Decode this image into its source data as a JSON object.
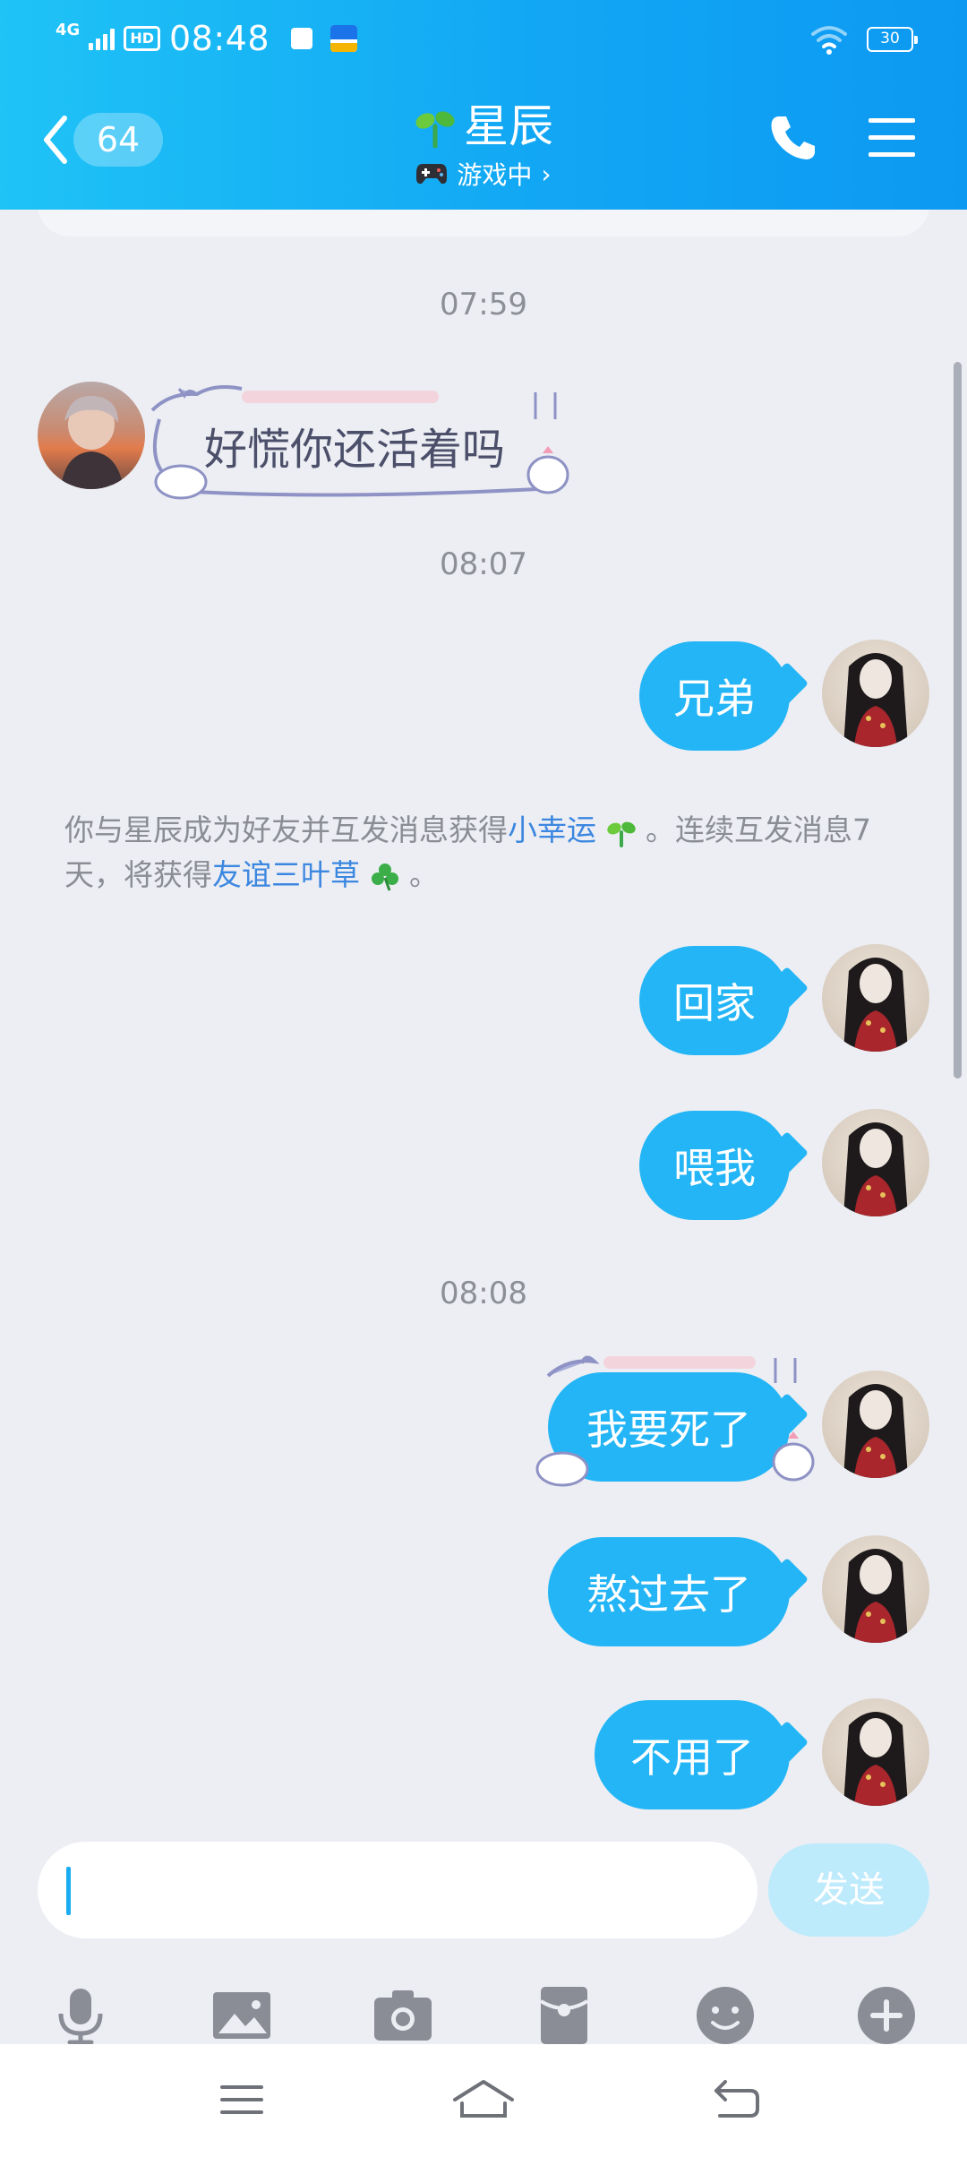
{
  "status_bar": {
    "network": "4G",
    "hd": "HD",
    "time": "08:48",
    "battery": "30"
  },
  "header": {
    "unread_count": "64",
    "contact_name": "星辰",
    "status_text": "游戏中",
    "status_chevron": "›",
    "icons": [
      "back-chevron-icon",
      "sprout-icon",
      "gamepad-icon",
      "phone-icon",
      "menu-icon"
    ]
  },
  "chat": {
    "time_1": "07:59",
    "msg_incoming_1": "好慌你还活着吗",
    "time_2": "08:07",
    "msg_out_1": "兄弟",
    "system_tip": {
      "part1": "你与星辰成为好友并互发消息获得",
      "highlight1": "小幸运",
      "part2": " 。连续互发消息7天，将获得",
      "highlight2": "友谊三叶草",
      "part3": " 。"
    },
    "msg_out_2": "回家",
    "msg_out_3": "喂我",
    "time_3": "08:08",
    "msg_out_4": "我要死了",
    "msg_out_5": "熬过去了",
    "msg_out_6": "不用了"
  },
  "input": {
    "value": "",
    "send_label": "发送",
    "tools": [
      "microphone-icon",
      "image-icon",
      "camera-icon",
      "red-packet-icon",
      "emoji-icon",
      "plus-icon"
    ]
  },
  "colors": {
    "header_start": "#1FC3F6",
    "header_end": "#0C99F2",
    "bubble": "#23B5F6",
    "background": "#ECEEF3",
    "send_disabled": "#BDEBFC",
    "highlight_link": "#3C87E0"
  }
}
